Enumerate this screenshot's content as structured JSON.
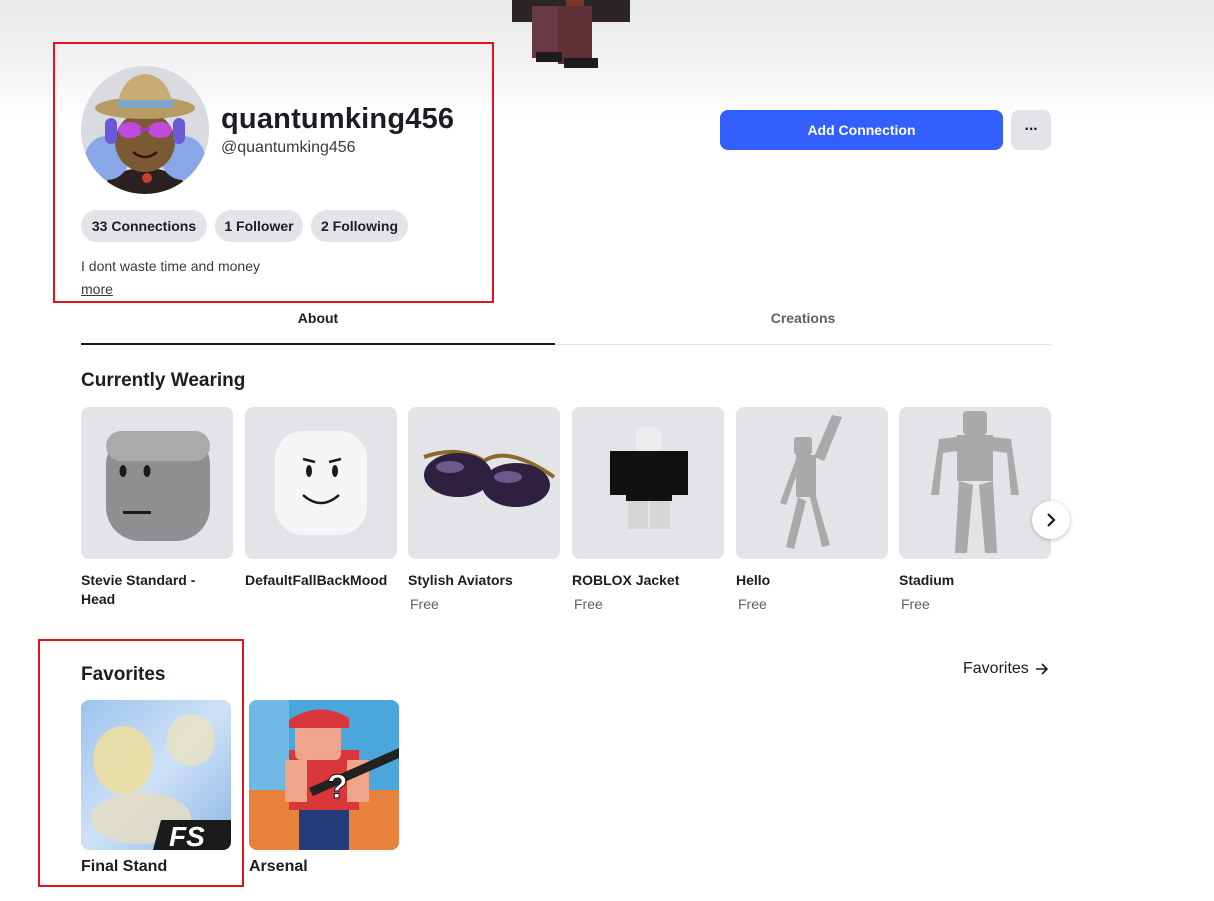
{
  "profile": {
    "display_name": "quantumking456",
    "username": "@quantumking456",
    "stats": {
      "connections": "33 Connections",
      "followers": "1 Follower",
      "following": "2 Following"
    },
    "bio": "I dont waste time and money",
    "more_label": "more"
  },
  "actions": {
    "add_connection_label": "Add Connection",
    "more_label": "···"
  },
  "tabs": [
    {
      "label": "About",
      "active": true
    },
    {
      "label": "Creations",
      "active": false
    }
  ],
  "currently_wearing": {
    "title": "Currently Wearing",
    "items": [
      {
        "name": "Stevie Standard - Head",
        "price": ""
      },
      {
        "name": "DefaultFallBackMood",
        "price": ""
      },
      {
        "name": "Stylish Aviators",
        "price": "Free"
      },
      {
        "name": "ROBLOX Jacket",
        "price": "Free"
      },
      {
        "name": "Hello",
        "price": "Free"
      },
      {
        "name": "Stadium",
        "price": "Free"
      }
    ]
  },
  "favorites": {
    "title": "Favorites",
    "link_label": "Favorites",
    "items": [
      {
        "name": "Final Stand",
        "badge": "FS"
      },
      {
        "name": "Arsenal"
      }
    ]
  },
  "colors": {
    "accent": "#335fff",
    "highlight": "#e3131b",
    "card_bg": "#e3e4e8"
  }
}
